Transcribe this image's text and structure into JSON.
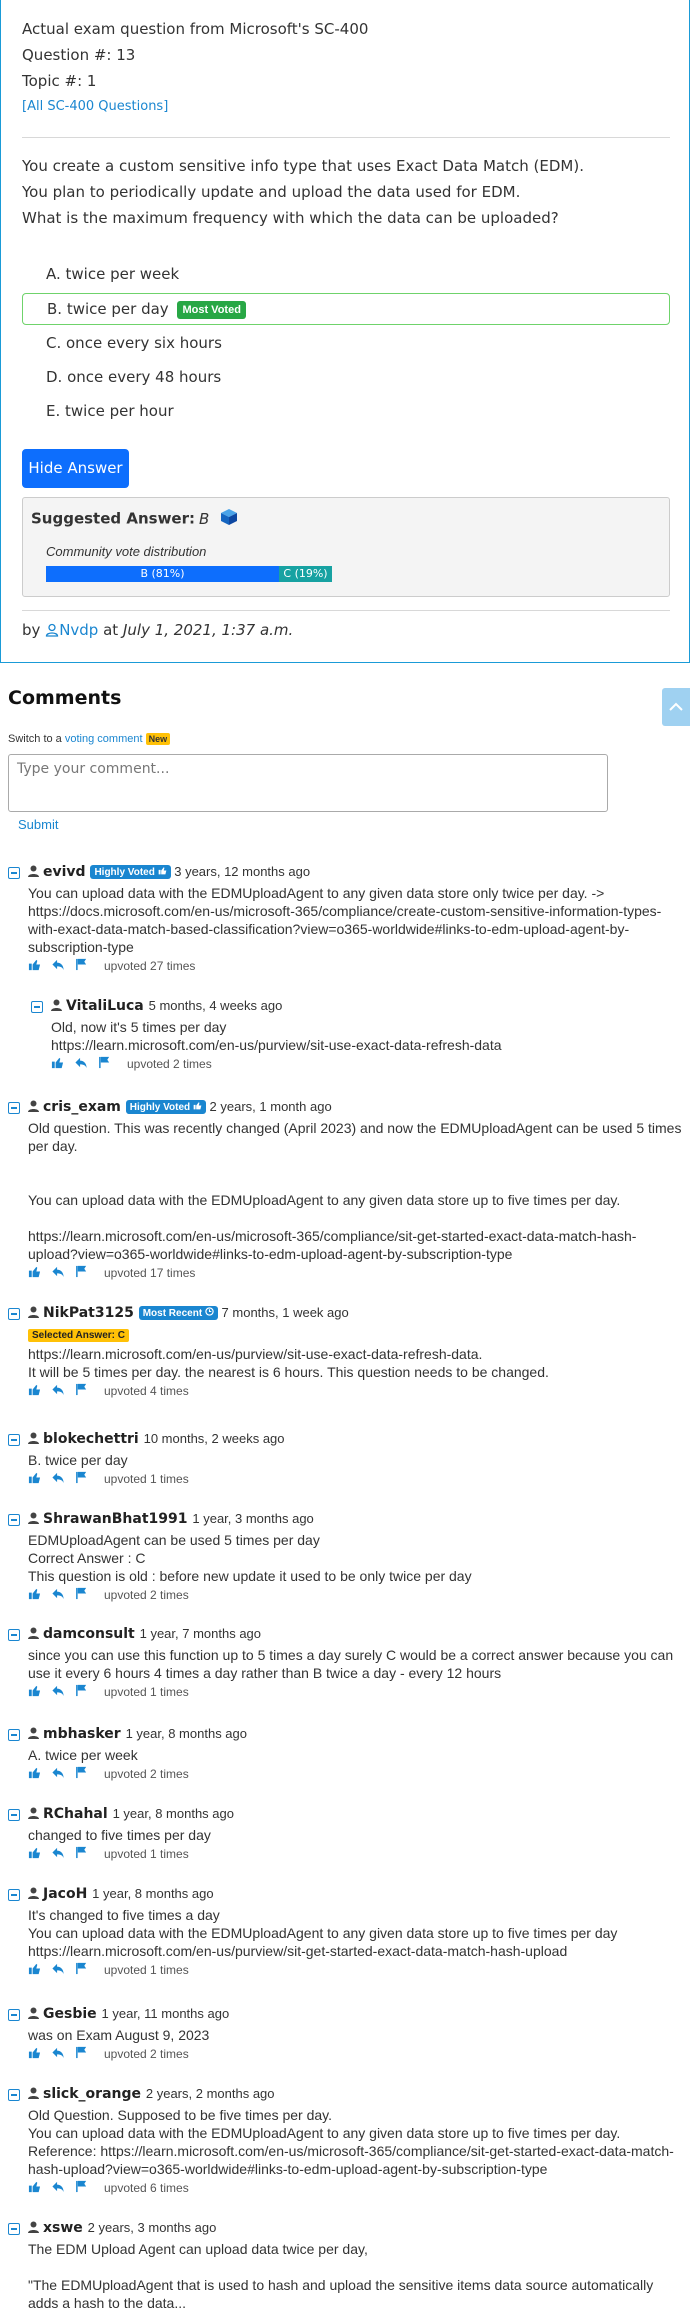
{
  "question": {
    "header_line": "Actual exam question from Microsoft's SC-400",
    "question_num": "Question #: 13",
    "topic": "Topic #: 1",
    "all_link": "[All SC-400 Questions]",
    "text_lines": [
      "You create a custom sensitive info type that uses Exact Data Match (EDM).",
      "You plan to periodically update and upload the data used for EDM.",
      "What is the maximum frequency with which the data can be uploaded?"
    ],
    "choices": [
      {
        "label": "A. twice per week"
      },
      {
        "label": "B. twice per day",
        "badge": "Most Voted"
      },
      {
        "label": "C. once every six hours"
      },
      {
        "label": "D. once every 48 hours"
      },
      {
        "label": "E. twice per hour"
      }
    ],
    "hide_button": "Hide Answer",
    "suggested_label": "Suggested Answer:",
    "suggested_value": "B",
    "community_label": "Community vote distribution",
    "votes": [
      {
        "label": "B (81%)",
        "pct": 81,
        "color": "#0d6efd"
      },
      {
        "label": "C (19%)",
        "pct": 19,
        "color": "#17a2a2"
      }
    ],
    "by": "by",
    "author": "Nvdp",
    "at": "at",
    "date": "July 1, 2021, 1:37 a.m."
  },
  "comments_section": {
    "title": "Comments",
    "switch_prefix": "Switch to a",
    "switch_link": "voting comment",
    "new_badge": "New",
    "placeholder": "Type your comment...",
    "submit": "Submit"
  },
  "comments": [
    {
      "user": "evivd",
      "badge": "Highly Voted",
      "time": "3 years, 12 months ago",
      "lines": [
        "You can upload data with the EDMUploadAgent to any given data store only twice per day. -> https://docs.microsoft.com/en-us/microsoft-365/compliance/create-custom-sensitive-information-types-with-exact-data-match-based-classification?view=o365-worldwide#links-to-edm-upload-agent-by-subscription-type"
      ],
      "upvotes": "upvoted 27 times"
    },
    {
      "user": "VitaliLuca",
      "time": "5 months, 4 weeks ago",
      "lines": [
        "Old, now it's 5 times per day",
        "https://learn.microsoft.com/en-us/purview/sit-use-exact-data-refresh-data"
      ],
      "upvotes": "upvoted 2 times"
    },
    {
      "user": "cris_exam",
      "badge": "Highly Voted",
      "time": "2 years, 1 month ago",
      "lines": [
        "Old question. This was recently changed (April 2023) and now the EDMUploadAgent can be used 5 times per day.",
        "",
        "",
        "You can upload data with the EDMUploadAgent to any given data store up to five times per day.",
        "",
        "https://learn.microsoft.com/en-us/microsoft-365/compliance/sit-get-started-exact-data-match-hash-upload?view=o365-worldwide#links-to-edm-upload-agent-by-subscription-type"
      ],
      "upvotes": "upvoted 17 times"
    },
    {
      "user": "NikPat3125",
      "badge": "Most Recent",
      "time": "7 months, 1 week ago",
      "selected": "Selected Answer: C",
      "lines": [
        "https://learn.microsoft.com/en-us/purview/sit-use-exact-data-refresh-data.",
        "It will be 5 times per day. the nearest is 6 hours. This question needs to be changed."
      ],
      "upvotes": "upvoted 4 times"
    },
    {
      "user": "blokechettri",
      "time": "10 months, 2 weeks ago",
      "lines": [
        "B. twice per day"
      ],
      "upvotes": "upvoted 1 times"
    },
    {
      "user": "ShrawanBhat1991",
      "time": "1 year, 3 months ago",
      "lines": [
        "EDMUploadAgent can be used 5 times per day",
        "Correct Answer : C",
        "This question is old : before new update it used to be only twice per day"
      ],
      "upvotes": "upvoted 2 times"
    },
    {
      "user": "damconsult",
      "time": "1 year, 7 months ago",
      "lines": [
        "since you can use this function up to 5 times a day surely C would be a correct answer because you can use it every 6 hours 4 times a day rather than B twice a day - every 12 hours"
      ],
      "upvotes": "upvoted 1 times"
    },
    {
      "user": "mbhasker",
      "time": "1 year, 8 months ago",
      "lines": [
        "A. twice per week"
      ],
      "upvotes": "upvoted 2 times"
    },
    {
      "user": "RChahal",
      "time": "1 year, 8 months ago",
      "lines": [
        "changed to five times per day"
      ],
      "upvotes": "upvoted 1 times"
    },
    {
      "user": "JacoH",
      "time": "1 year, 8 months ago",
      "lines": [
        "It's changed to five times a day",
        "You can upload data with the EDMUploadAgent to any given data store up to five times per day",
        "https://learn.microsoft.com/en-us/purview/sit-get-started-exact-data-match-hash-upload"
      ],
      "upvotes": "upvoted 1 times"
    },
    {
      "user": "Gesbie",
      "time": "1 year, 11 months ago",
      "lines": [
        "was on Exam August 9, 2023"
      ],
      "upvotes": "upvoted 2 times"
    },
    {
      "user": "slick_orange",
      "time": "2 years, 2 months ago",
      "lines": [
        "Old Question. Supposed to be five times per day.",
        "You can upload data with the EDMUploadAgent to any given data store up to five times per day.",
        "Reference: https://learn.microsoft.com/en-us/microsoft-365/compliance/sit-get-started-exact-data-match-hash-upload?view=o365-worldwide#links-to-edm-upload-agent-by-subscription-type"
      ],
      "upvotes": "upvoted 6 times"
    },
    {
      "user": "xswe",
      "time": "2 years, 3 months ago",
      "lines": [
        "The EDM Upload Agent can upload data twice per day,",
        "",
        "\"The EDMUploadAgent that is used to hash and upload the sensitive items data source automatically adds a hash to the data..."
      ],
      "upvotes": ""
    }
  ]
}
